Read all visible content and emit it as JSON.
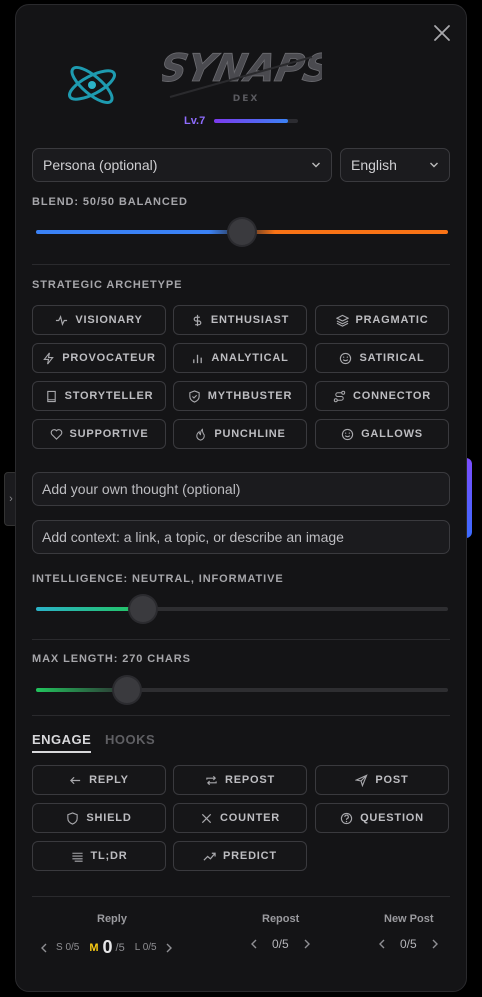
{
  "app": {
    "logo_text": "SYNAPS",
    "logo_sub": "DEX",
    "level": "Lv.7",
    "level_progress": 0.88
  },
  "selects": {
    "persona": "Persona (optional)",
    "language": "English"
  },
  "blend": {
    "label": "BLEND: 50/50 BALANCED",
    "value": 0.5
  },
  "archetype": {
    "label": "STRATEGIC ARCHETYPE",
    "items": [
      {
        "label": "VISIONARY",
        "icon": "pulse-icon"
      },
      {
        "label": "ENTHUSIAST",
        "icon": "dollar-icon"
      },
      {
        "label": "PRAGMATIC",
        "icon": "layers-icon"
      },
      {
        "label": "PROVOCATEUR",
        "icon": "bolt-icon"
      },
      {
        "label": "ANALYTICAL",
        "icon": "bar-chart-icon"
      },
      {
        "label": "SATIRICAL",
        "icon": "smile-icon"
      },
      {
        "label": "STORYTELLER",
        "icon": "book-icon"
      },
      {
        "label": "MYTHBUSTER",
        "icon": "shield-check-icon"
      },
      {
        "label": "CONNECTOR",
        "icon": "route-icon"
      },
      {
        "label": "SUPPORTIVE",
        "icon": "heart-icon"
      },
      {
        "label": "PUNCHLINE",
        "icon": "flame-icon"
      },
      {
        "label": "GALLOWS",
        "icon": "smile-icon"
      }
    ]
  },
  "inputs": {
    "thought_placeholder": "Add your own thought (optional)",
    "context_placeholder": "Add context: a link, a topic, or describe an image"
  },
  "intelligence": {
    "label": "INTELLIGENCE: NEUTRAL, INFORMATIVE",
    "value": 0.26
  },
  "max_length": {
    "label": "MAX LENGTH: 270 CHARS",
    "value": 0.22
  },
  "tabs": [
    {
      "label": "ENGAGE"
    },
    {
      "label": "HOOKS"
    }
  ],
  "actions": [
    {
      "label": "REPLY",
      "icon": "reply-icon"
    },
    {
      "label": "REPOST",
      "icon": "repost-icon"
    },
    {
      "label": "POST",
      "icon": "send-icon"
    },
    {
      "label": "SHIELD",
      "icon": "shield-icon"
    },
    {
      "label": "COUNTER",
      "icon": "x-icon"
    },
    {
      "label": "QUESTION",
      "icon": "help-circle-icon"
    },
    {
      "label": "TL;DR",
      "icon": "lines-icon"
    },
    {
      "label": "PREDICT",
      "icon": "trend-icon"
    }
  ],
  "footer": {
    "reply": {
      "label": "Reply",
      "s": "S 0/5",
      "m_letter": "M",
      "m_value": "0",
      "m_total": "/5",
      "l": "L 0/5"
    },
    "repost": {
      "label": "Repost",
      "count": "0/5"
    },
    "new_post": {
      "label": "New Post",
      "count": "0/5"
    }
  },
  "colors": {
    "blue": "#3b82f6",
    "orange": "#f97316",
    "purple": "#8f6dff",
    "green": "#22c55e",
    "teal": "#2bb3c8",
    "yellow": "#facc15"
  }
}
